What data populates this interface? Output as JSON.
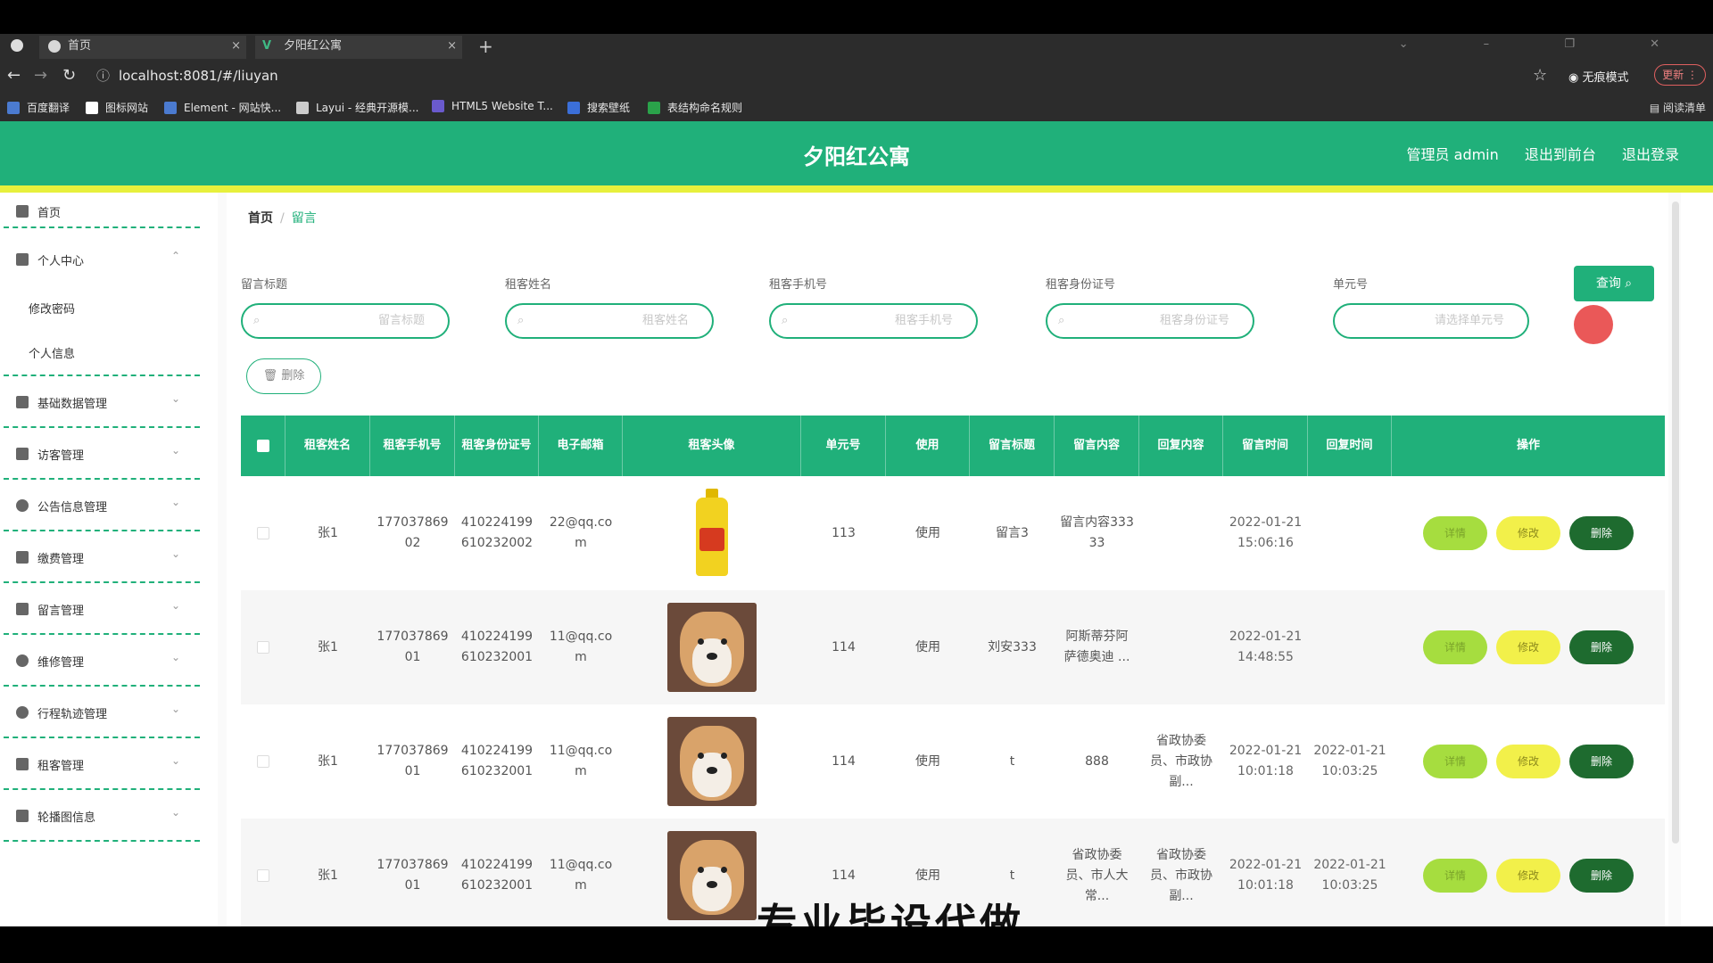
{
  "browser": {
    "tabs": [
      {
        "label": "首页",
        "close": "×"
      },
      {
        "label": "夕阳红公寓",
        "close": "×"
      }
    ],
    "new_tab": "+",
    "url": "localhost:8081/#/liuyan",
    "incognito_label": "无痕模式",
    "update_label": "更新 ⋮",
    "bookmarks": [
      "百度翻译",
      "图标网站",
      "Element - 网站快...",
      "Layui - 经典开源模...",
      "HTML5 Website T...",
      "搜索壁纸",
      "表结构命名规则"
    ],
    "reading_list": "阅读清单"
  },
  "header": {
    "title": "夕阳红公寓",
    "admin": "管理员 admin",
    "exit_front": "退出到前台",
    "logout": "退出登录",
    "color": "#20b07a"
  },
  "sidebar": {
    "items": [
      {
        "label": "首页",
        "icon": "home-icon"
      },
      {
        "label": "个人中心",
        "icon": "user-icon",
        "children": [
          "修改密码",
          "个人信息"
        ]
      },
      {
        "label": "基础数据管理",
        "icon": "grid-icon"
      },
      {
        "label": "访客管理",
        "icon": "building-icon"
      },
      {
        "label": "公告信息管理",
        "icon": "compass-icon"
      },
      {
        "label": "缴费管理",
        "icon": "chat-icon"
      },
      {
        "label": "留言管理",
        "icon": "briefcase-icon"
      },
      {
        "label": "维修管理",
        "icon": "bell-off-icon"
      },
      {
        "label": "行程轨迹管理",
        "icon": "power-icon"
      },
      {
        "label": "租客管理",
        "icon": "building-icon"
      },
      {
        "label": "轮播图信息",
        "icon": "user-icon"
      }
    ]
  },
  "breadcrumb": {
    "home": "首页",
    "sep": "/",
    "current": "留言"
  },
  "search": {
    "fields": [
      {
        "label": "留言标题",
        "placeholder": "留言标题"
      },
      {
        "label": "租客姓名",
        "placeholder": "租客姓名"
      },
      {
        "label": "租客手机号",
        "placeholder": "租客手机号"
      },
      {
        "label": "租客身份证号",
        "placeholder": "租客身份证号"
      },
      {
        "label": "单元号",
        "placeholder": "请选择单元号"
      }
    ],
    "query_label": "查询",
    "delete_label": "删除"
  },
  "table": {
    "headers": [
      "租客姓名",
      "租客手机号",
      "租客身份证号",
      "电子邮箱",
      "租客头像",
      "单元号",
      "使用",
      "留言标题",
      "留言内容",
      "回复内容",
      "留言时间",
      "回复时间",
      "操作"
    ],
    "rows": [
      {
        "name": "张1",
        "phone": "17703786902",
        "idcard": "410224199610232002",
        "email": "22@qq.com",
        "avatar": "oil-bottle",
        "unit": "113",
        "use": "使用",
        "title": "留言3",
        "content": "留言内容33333",
        "reply": "",
        "time": "2022-01-21 15:06:16",
        "reply_time": ""
      },
      {
        "name": "张1",
        "phone": "17703786901",
        "idcard": "410224199610232001",
        "email": "11@qq.com",
        "avatar": "shiba-dog",
        "unit": "114",
        "use": "使用",
        "title": "刘安333",
        "content": "阿斯蒂芬阿萨德奥迪 ...",
        "reply": "",
        "time": "2022-01-21 14:48:55",
        "reply_time": ""
      },
      {
        "name": "张1",
        "phone": "17703786901",
        "idcard": "410224199610232001",
        "email": "11@qq.com",
        "avatar": "shiba-dog",
        "unit": "114",
        "use": "使用",
        "title": "t",
        "content": "888",
        "reply": "省政协委员、市政协副...",
        "time": "2022-01-21 10:01:18",
        "reply_time": "2022-01-21 10:03:25"
      },
      {
        "name": "张1",
        "phone": "17703786901",
        "idcard": "410224199610232001",
        "email": "11@qq.com",
        "avatar": "shiba-dog",
        "unit": "114",
        "use": "使用",
        "title": "t",
        "content": "省政协委员、市人大常...",
        "reply": "省政协委员、市政协副...",
        "time": "2022-01-21 10:01:18",
        "reply_time": "2022-01-21 10:03:25"
      }
    ],
    "ops": {
      "detail": "详情",
      "edit": "修改",
      "del": "删除"
    }
  },
  "overlay_text": "专业毕设代做"
}
